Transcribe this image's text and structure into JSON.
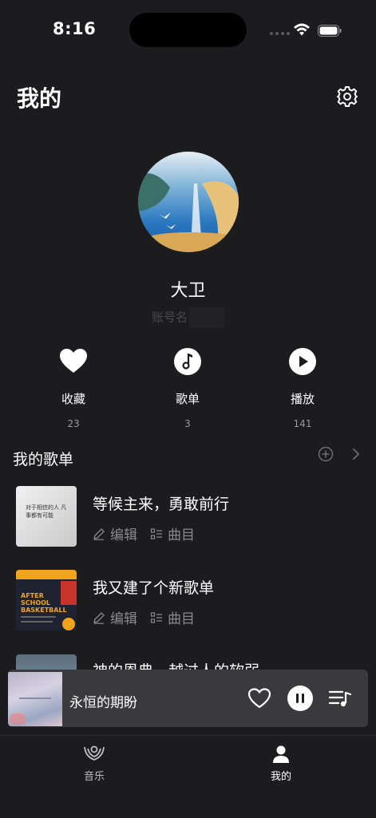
{
  "status": {
    "time": "8:16"
  },
  "header": {
    "title": "我的",
    "settings_icon": "gear-icon"
  },
  "profile": {
    "name": "大卫",
    "account_label": "账号名"
  },
  "stats": [
    {
      "label": "收藏",
      "count": "23",
      "icon": "heart-icon"
    },
    {
      "label": "歌单",
      "count": "3",
      "icon": "music-note-icon"
    },
    {
      "label": "播放",
      "count": "141",
      "icon": "play-icon"
    }
  ],
  "playlists_section": {
    "title": "我的歌单"
  },
  "playlists": [
    {
      "name": "等候主来，勇敢前行",
      "edit_label": "编辑",
      "tracks_label": "曲目",
      "cover_text": "对于相信的人 凡事都有可能"
    },
    {
      "name": "我又建了个新歌单",
      "edit_label": "编辑",
      "tracks_label": "曲目",
      "cover_text": "AFTER SCHOOL BASKETBALL"
    },
    {
      "name": "神的恩典，越过人的软弱"
    }
  ],
  "player": {
    "title": "永恒的期盼"
  },
  "tabbar": {
    "tabs": [
      {
        "label": "音乐",
        "icon": "music-hands-icon"
      },
      {
        "label": "我的",
        "icon": "person-icon"
      }
    ]
  },
  "colors": {
    "background": "#1c1c1e",
    "player_bg": "#3a3a3c",
    "muted": "#8a8a8e"
  }
}
